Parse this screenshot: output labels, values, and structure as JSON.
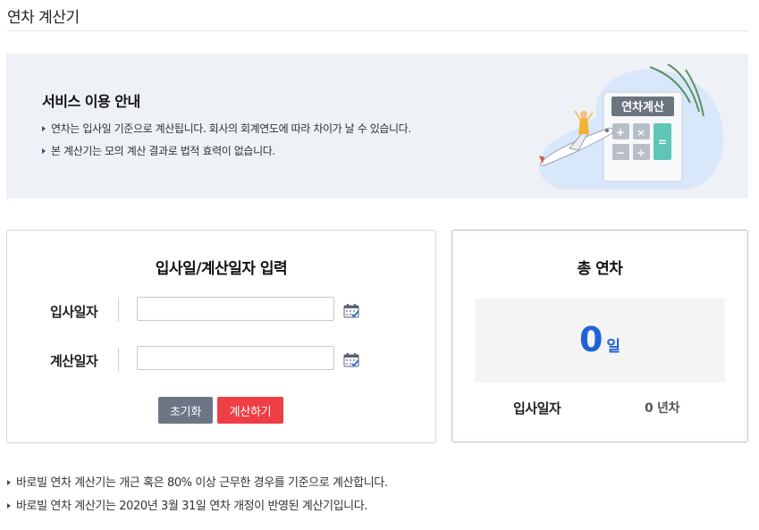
{
  "page": {
    "title": "연차 계산기"
  },
  "notice": {
    "title": "서비스 이용 안내",
    "lines": [
      "연차는 입사일 기준으로 계산됩니다. 회사의 회계연도에 따라 차이가 날 수 있습니다.",
      "본 계산기는 모의 계산 결과로 법적 효력이 없습니다."
    ],
    "illustration_label": "연차계산"
  },
  "input_card": {
    "heading": "입사일/계산일자 입력",
    "fields": [
      {
        "label": "입사일자",
        "value": "",
        "placeholder": "",
        "icon": "calendar-icon"
      },
      {
        "label": "계산일자",
        "value": "",
        "placeholder": "",
        "icon": "calendar-icon"
      }
    ],
    "buttons": {
      "reset": "초기화",
      "calculate": "계산하기"
    }
  },
  "result_card": {
    "heading": "총 연차",
    "value": "0",
    "unit": "일",
    "join_label": "입사일자",
    "years": "0 년차"
  },
  "notes": [
    "바로빌 연차 계산기는 개근 혹은 80% 이상 근무한 경우를 기준으로 계산합니다.",
    "바로빌 연차 계산기는 2020년 3월 31일 연차 개정이 반영된 계산기입니다."
  ],
  "colors": {
    "accent_blue": "#2163d6",
    "button_reset": "#6d7585",
    "button_calculate": "#ee3e46",
    "notice_bg": "#eef1f6"
  }
}
